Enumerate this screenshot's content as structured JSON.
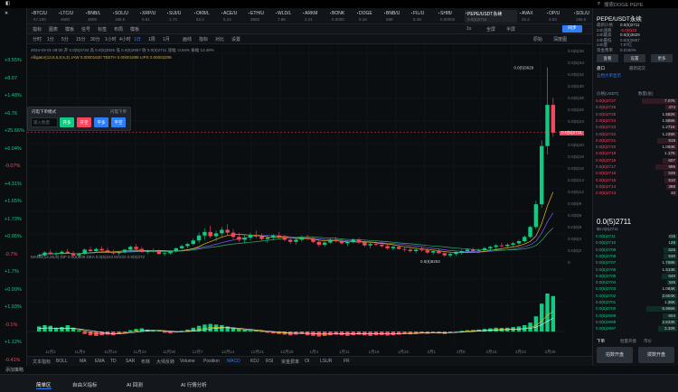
{
  "window": {
    "search_placeholder": "搜索DOGE PEPE"
  },
  "ticker": [
    {
      "name": "BTC/U",
      "val": "67,100"
    },
    {
      "name": "LTC/U",
      "val": "4600"
    },
    {
      "name": "BNB/L",
      "val": "4600"
    },
    {
      "name": "SOL/U",
      "val": "185.5"
    },
    {
      "name": "XRP/U",
      "val": "0.61"
    },
    {
      "name": "SUI/U",
      "val": "1.73"
    },
    {
      "name": "OKB/L",
      "val": "53.2"
    },
    {
      "name": "ACE/U",
      "val": "5.24"
    },
    {
      "name": "ETH/U",
      "val": "3550"
    },
    {
      "name": "WLD/L",
      "val": "7.88"
    },
    {
      "name": "ARKM",
      "val": "2.21"
    },
    {
      "name": "BONK",
      "val": "0.0000"
    },
    {
      "name": "DOGE",
      "val": "0.16"
    },
    {
      "name": "BNB/U",
      "val": "588"
    },
    {
      "name": "FIL/U",
      "val": "8.48"
    },
    {
      "name": "SHIB/",
      "val": "0.00002"
    },
    {
      "name": "PEPE/USDT永续",
      "val": "0.0(5)2711"
    },
    {
      "name": "AVAX",
      "val": "45.2"
    },
    {
      "name": "OP/U",
      "val": "3.63"
    },
    {
      "name": "SOL/U",
      "val": "185.5"
    }
  ],
  "toolbar1": {
    "items": [
      "指标",
      "图表",
      "模板",
      "信号",
      "标签",
      "布局",
      "模板"
    ],
    "right": [
      "1x",
      "全屏",
      "半屏"
    ],
    "sync_label": "同步"
  },
  "toolbar2": {
    "timeframes": [
      "分时",
      "1分",
      "5分",
      "15分",
      "30分",
      "1小时",
      "4小时",
      "1日",
      "1周",
      "1月"
    ],
    "active": "1日",
    "drawtools": [
      "画线",
      "指标",
      "对比",
      "设置"
    ],
    "right": [
      "原始",
      "深度图"
    ]
  },
  "chart_legend": {
    "line1": "2024-03-01 08:00  开 0.0(5)2734  高 0.0(5)3025  低 0.0(5)2657  收 0.0(5)2711  涨幅 -0.84%  振幅 13.48%",
    "line2": "Alligator(13,8,5,8,5,3)  JAW 0.00001620  TEETH 0.00001898  LIPS 0.00002208",
    "macd": "MACD(12,26,9)  DIF 0.0(6)409  DEA 0.0(6)223  MACD 0.0(6)372"
  },
  "chart_data": {
    "type": "candlestick",
    "title": "PEPE/USDT永续 1日",
    "price_labels": [
      "0.0(5)3629",
      "0.0(5)3375",
      "0.0(5)2711",
      "0.0(6)9253"
    ],
    "current_price": "0.0(5)2711",
    "xlabels": [
      "11月2",
      "11月9",
      "11月16",
      "11月23",
      "11月30",
      "12月7",
      "12月14",
      "12月21",
      "12月28",
      "1月4",
      "1月11",
      "1月18",
      "1月25",
      "2月1",
      "2月8",
      "2月15",
      "2月22",
      "2月29"
    ],
    "candles": [
      [
        0.97,
        1.0,
        0.95,
        0.98
      ],
      [
        0.98,
        1.04,
        0.96,
        1.02
      ],
      [
        1.02,
        1.06,
        0.99,
        1.0
      ],
      [
        1.0,
        1.03,
        0.97,
        1.01
      ],
      [
        1.01,
        1.05,
        0.99,
        1.03
      ],
      [
        1.03,
        1.07,
        1.0,
        1.01
      ],
      [
        1.01,
        1.04,
        0.97,
        0.98
      ],
      [
        0.98,
        1.02,
        0.95,
        1.0
      ],
      [
        1.0,
        1.08,
        0.99,
        1.06
      ],
      [
        1.06,
        1.1,
        1.02,
        1.04
      ],
      [
        1.04,
        1.09,
        1.03,
        1.07
      ],
      [
        1.07,
        1.11,
        1.04,
        1.05
      ],
      [
        1.05,
        1.09,
        1.02,
        1.03
      ],
      [
        1.03,
        1.06,
        0.99,
        1.01
      ],
      [
        1.01,
        1.04,
        0.98,
        1.03
      ],
      [
        1.03,
        1.07,
        1.01,
        1.06
      ],
      [
        1.06,
        1.12,
        1.04,
        1.1
      ],
      [
        1.1,
        1.14,
        1.05,
        1.07
      ],
      [
        1.07,
        1.1,
        1.02,
        1.03
      ],
      [
        1.03,
        1.06,
        1.0,
        1.05
      ],
      [
        1.05,
        1.08,
        1.02,
        1.04
      ],
      [
        1.04,
        1.06,
        0.99,
        1.0
      ],
      [
        1.0,
        1.03,
        0.97,
        1.01
      ],
      [
        1.01,
        1.05,
        0.99,
        1.04
      ],
      [
        1.04,
        1.09,
        1.02,
        1.08
      ],
      [
        1.08,
        1.13,
        1.06,
        1.11
      ],
      [
        1.11,
        1.16,
        1.08,
        1.14
      ],
      [
        1.14,
        1.22,
        1.12,
        1.19
      ],
      [
        1.19,
        1.3,
        1.15,
        1.26
      ],
      [
        1.26,
        1.36,
        1.2,
        1.31
      ],
      [
        1.31,
        1.4,
        1.22,
        1.25
      ],
      [
        1.25,
        1.33,
        1.18,
        1.29
      ],
      [
        1.29,
        1.38,
        1.24,
        1.34
      ],
      [
        1.34,
        1.42,
        1.26,
        1.3
      ],
      [
        1.3,
        1.35,
        1.21,
        1.24
      ],
      [
        1.24,
        1.3,
        1.17,
        1.2
      ],
      [
        1.2,
        1.27,
        1.15,
        1.23
      ],
      [
        1.23,
        1.3,
        1.19,
        1.27
      ],
      [
        1.27,
        1.33,
        1.22,
        1.25
      ],
      [
        1.25,
        1.29,
        1.19,
        1.21
      ],
      [
        1.21,
        1.26,
        1.16,
        1.23
      ],
      [
        1.23,
        1.28,
        1.2,
        1.26
      ],
      [
        1.26,
        1.31,
        1.22,
        1.24
      ],
      [
        1.24,
        1.27,
        1.18,
        1.2
      ],
      [
        1.2,
        1.24,
        1.14,
        1.17
      ],
      [
        1.17,
        1.22,
        1.13,
        1.2
      ],
      [
        1.2,
        1.26,
        1.17,
        1.23
      ],
      [
        1.23,
        1.27,
        1.19,
        1.21
      ],
      [
        1.21,
        1.24,
        1.15,
        1.17
      ],
      [
        1.17,
        1.2,
        1.1,
        1.13
      ],
      [
        1.13,
        1.18,
        1.1,
        1.16
      ],
      [
        1.16,
        1.22,
        1.14,
        1.2
      ],
      [
        1.2,
        1.24,
        1.16,
        1.18
      ],
      [
        1.18,
        1.21,
        1.13,
        1.15
      ],
      [
        1.15,
        1.19,
        1.11,
        1.17
      ],
      [
        1.17,
        1.22,
        1.15,
        1.2
      ],
      [
        1.2,
        1.23,
        1.14,
        1.16
      ],
      [
        1.16,
        1.19,
        1.1,
        1.12
      ],
      [
        1.12,
        1.16,
        1.08,
        1.14
      ],
      [
        1.14,
        1.18,
        1.11,
        1.13
      ],
      [
        1.13,
        1.17,
        1.09,
        1.11
      ],
      [
        1.11,
        1.14,
        1.06,
        1.08
      ],
      [
        1.08,
        1.12,
        1.05,
        1.1
      ],
      [
        1.1,
        1.13,
        1.06,
        1.07
      ],
      [
        1.07,
        1.1,
        1.03,
        1.06
      ],
      [
        1.06,
        1.09,
        1.02,
        1.04
      ],
      [
        1.04,
        1.08,
        1.01,
        1.06
      ],
      [
        1.06,
        1.1,
        1.03,
        1.05
      ],
      [
        1.05,
        1.08,
        1.0,
        1.02
      ],
      [
        1.02,
        1.06,
        0.99,
        1.04
      ],
      [
        1.04,
        1.07,
        1.0,
        1.01
      ],
      [
        1.01,
        1.04,
        0.96,
        0.98
      ],
      [
        0.98,
        1.02,
        0.95,
        1.0
      ],
      [
        1.0,
        1.04,
        0.97,
        1.02
      ],
      [
        1.02,
        1.06,
        0.99,
        1.04
      ],
      [
        1.04,
        1.08,
        1.01,
        1.06
      ],
      [
        1.06,
        1.09,
        1.02,
        1.04
      ],
      [
        1.04,
        1.07,
        1.01,
        1.05
      ],
      [
        1.05,
        1.1,
        1.03,
        1.08
      ],
      [
        1.08,
        1.12,
        1.05,
        1.1
      ],
      [
        1.1,
        1.14,
        1.07,
        1.12
      ],
      [
        1.12,
        1.16,
        1.08,
        1.11
      ],
      [
        1.11,
        1.15,
        1.08,
        1.13
      ],
      [
        1.13,
        1.17,
        1.1,
        1.15
      ],
      [
        1.15,
        1.2,
        1.12,
        1.18
      ],
      [
        1.18,
        1.26,
        1.16,
        1.24
      ],
      [
        1.24,
        1.4,
        1.22,
        1.38
      ],
      [
        1.38,
        1.75,
        1.35,
        1.7
      ],
      [
        1.7,
        2.6,
        1.65,
        2.52
      ],
      [
        2.52,
        3.63,
        2.4,
        3.1
      ],
      [
        3.1,
        3.2,
        2.65,
        2.71
      ]
    ],
    "macd": [
      0.4,
      0.5,
      0.45,
      0.3,
      0.35,
      0.5,
      0.3,
      0.1,
      -0.2,
      -0.3,
      -0.35,
      -0.3,
      -0.25,
      -0.3,
      -0.2,
      -0.1,
      0.1,
      0.2,
      0.25,
      0.15,
      0.1,
      0.05,
      -0.1,
      -0.15,
      -0.05,
      0.05,
      0.15,
      0.3,
      0.45,
      0.55,
      0.6,
      0.55,
      0.5,
      0.4,
      0.3,
      0.2,
      0.15,
      0.1,
      0.05,
      -0.05,
      -0.1,
      -0.15,
      -0.2,
      -0.25,
      -0.3,
      -0.25,
      -0.2,
      -0.3,
      -0.35,
      -0.4,
      -0.35,
      -0.3,
      -0.25,
      -0.3,
      -0.35,
      -0.3,
      -0.25,
      -0.3,
      -0.35,
      -0.3,
      -0.28,
      -0.32,
      -0.3,
      -0.25,
      -0.2,
      -0.22,
      -0.2,
      -0.15,
      -0.18,
      -0.12,
      -0.15,
      -0.2,
      -0.1,
      -0.05,
      0.05,
      0.1,
      0.12,
      0.15,
      0.2,
      0.25,
      0.3,
      0.28,
      0.3,
      0.35,
      0.4,
      0.5,
      0.7,
      1.2,
      2.2,
      3.0,
      2.8
    ],
    "ylim": [
      0.9,
      3.7
    ]
  },
  "left_values": [
    {
      "v": "+3.55%",
      "c": "green"
    },
    {
      "v": "+8.07",
      "c": "green"
    },
    {
      "v": "+1.48%",
      "c": "green"
    },
    {
      "v": "+6.76",
      "c": "green"
    },
    {
      "v": "+25.66%",
      "c": "green"
    },
    {
      "v": "+6.04%",
      "c": "green"
    },
    {
      "v": "-0.07%",
      "c": "red"
    },
    {
      "v": "+4.31%",
      "c": "green"
    },
    {
      "v": "+1.65%",
      "c": "green"
    },
    {
      "v": "+1.73%",
      "c": "green"
    },
    {
      "v": "+0.95%",
      "c": "green"
    },
    {
      "v": "-0.7%",
      "c": "red"
    },
    {
      "v": "+1.7%",
      "c": "green"
    },
    {
      "v": "+0.99%",
      "c": "green"
    },
    {
      "v": "+1.93%",
      "c": "green"
    },
    {
      "v": "-0.1%",
      "c": "red"
    },
    {
      "v": "+1.12%",
      "c": "green"
    },
    {
      "v": "-0.41%",
      "c": "red"
    }
  ],
  "price_axis": [
    "0.0(5)36",
    "0.0(5)34",
    "0.0(5)32",
    "0.0(5)30",
    "0.0(5)28",
    "0.0(5)26",
    "0.0(5)24",
    "0.0(5)22",
    "0.0(5)20",
    "0.0(5)18",
    "0.0(5)16",
    "0.0(5)14",
    "0.0(5)12",
    "0.0(6)9",
    "0.0(6)8",
    "0.0(6)8",
    "0.0(6)4",
    "0.0(6)2",
    "0"
  ],
  "popup": {
    "title": "闪电下单模式",
    "right": "闪电下单",
    "placeholder": "输入数量",
    "buy": "开多",
    "sell": "开空",
    "close": "平多",
    "close2": "平空"
  },
  "bottom1": {
    "items": [
      "文本指标",
      "BOLL",
      "MA",
      "EMA",
      "TD",
      "SAR",
      "布林",
      "大师反转",
      "Volume",
      "Position",
      "MACD",
      "KDJ",
      "RSI",
      "资金费率",
      "OI",
      "LSUR",
      "FR"
    ],
    "active": "MACD"
  },
  "bottom0": {
    "left": "添加策略"
  },
  "bottom2": {
    "items": [
      "简单区",
      "自由义指标",
      "AI 回测",
      "AI 行情分析"
    ],
    "active": "简单区"
  },
  "right": {
    "title": "PEPE/USDT永续",
    "k": [
      [
        "最新价格",
        "0.0(5)2711"
      ],
      [
        "24h涨跌",
        "-0.0(6)23"
      ],
      [
        "24h最高",
        "0.0(5)3629"
      ],
      [
        "24h最低",
        "0.0(5)2657"
      ],
      [
        "24h量",
        "7.07亿"
      ],
      [
        "资金费率",
        "0.0150%"
      ]
    ],
    "buttons": [
      "查看",
      "设置",
      "更多"
    ],
    "tabs": [
      "盘口",
      "最新成交"
    ],
    "ob_head": [
      "价格(USDT)",
      "数量(张)"
    ],
    "ob_title": "五档大单显示",
    "big_price": "0.0(5)2711",
    "big_sub": "$0.0(5)2711",
    "asks": [
      [
        "0.0(5)2727",
        "7.07K"
      ],
      [
        "0.0(5)2726",
        "474"
      ],
      [
        "0.0(5)2725",
        "1.582K"
      ],
      [
        "0.0(5)2724",
        "1.565K"
      ],
      [
        "0.0(5)2723",
        "1.271K"
      ],
      [
        "0.0(5)2722",
        "1.225K"
      ],
      [
        "0.0(5)2721",
        "919"
      ],
      [
        "0.0(5)2720",
        "1.084K"
      ],
      [
        "0.0(5)2719",
        "1.17K"
      ],
      [
        "0.0(5)2718",
        "607"
      ],
      [
        "0.0(5)2717",
        "995"
      ],
      [
        "0.0(5)2716",
        "535"
      ],
      [
        "0.0(5)2715",
        "510"
      ],
      [
        "0.0(5)2714",
        "386"
      ],
      [
        "0.0(5)2713",
        "34"
      ]
    ],
    "bids": [
      [
        "0.0(5)2711",
        "215"
      ],
      [
        "0.0(5)2710",
        "129"
      ],
      [
        "0.0(5)2709",
        "526"
      ],
      [
        "0.0(5)2708",
        "530"
      ],
      [
        "0.0(5)2707",
        "1.768K"
      ],
      [
        "0.0(5)2706",
        "1.514K"
      ],
      [
        "0.0(5)2705",
        "640"
      ],
      [
        "0.0(5)2704",
        "346"
      ],
      [
        "0.0(5)2703",
        "1.084K"
      ],
      [
        "0.0(5)2702",
        "2.604K"
      ],
      [
        "0.0(5)2701",
        "1.36K"
      ],
      [
        "0.0(5)2700",
        "5.955K"
      ],
      [
        "0.0(5)2699",
        "604"
      ],
      [
        "0.0(5)2698",
        "2.633K"
      ],
      [
        "0.0(5)2697",
        "3.32K"
      ]
    ],
    "order_tabs": [
      "下单",
      "批量开盘",
      "市价"
    ],
    "btn_left": "拍数开盘",
    "btn_right": "拨数开盘"
  },
  "colors": {
    "up": "#0ecb81",
    "down": "#f6465d",
    "accent": "#2f7ef8"
  }
}
